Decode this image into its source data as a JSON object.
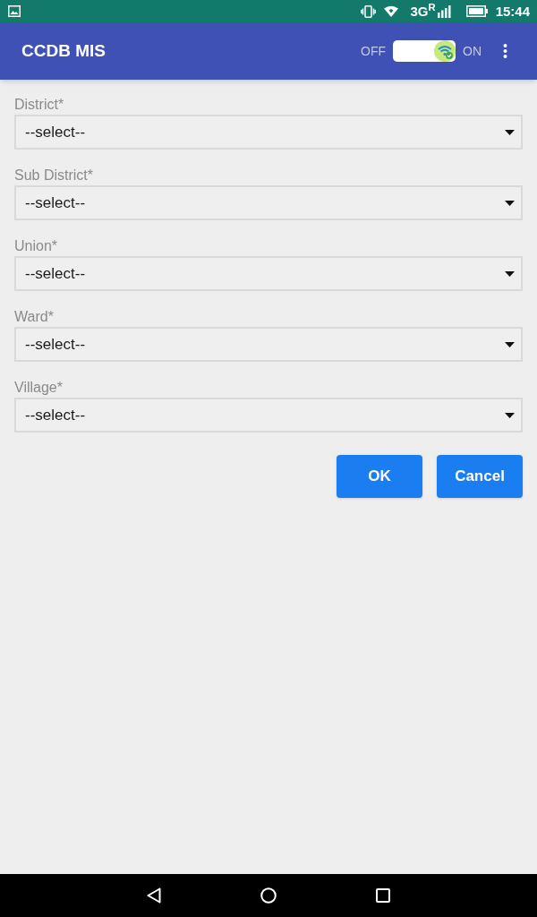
{
  "status_bar": {
    "network": "3G$^{R}$",
    "time": "15:44"
  },
  "app_bar": {
    "title": "CCDB MIS",
    "toggle": {
      "off_label": "OFF",
      "on_label": "ON",
      "on": true
    }
  },
  "form": {
    "fields": [
      {
        "label": "District*",
        "value": "--select--"
      },
      {
        "label": "Sub District*",
        "value": "--select--"
      },
      {
        "label": "Union*",
        "value": "--select--"
      },
      {
        "label": "Ward*",
        "value": "--select--"
      },
      {
        "label": "Village*",
        "value": "--select--"
      }
    ]
  },
  "buttons": [
    {
      "label": "OK"
    },
    {
      "label": "Cancel"
    }
  ]
}
